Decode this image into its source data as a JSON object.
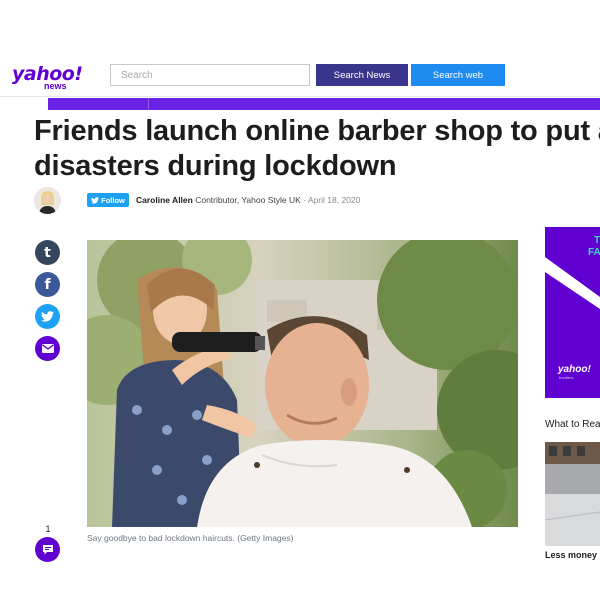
{
  "header": {
    "logo_main": "yahoo!",
    "logo_sub": "news",
    "search_placeholder": "Search",
    "search_news_label": "Search News",
    "search_web_label": "Search web"
  },
  "article": {
    "headline_line1": "Friends launch online barber shop to put an e",
    "headline_line2": "disasters during lockdown",
    "follow_label": "Follow",
    "author": "Caroline Allen",
    "role": "Contributor,",
    "outlet": "Yahoo Style UK",
    "separator": "·",
    "date": "April 18, 2020",
    "caption": "Say goodbye to bad lockdown haircuts. (Getty Images)"
  },
  "share": {
    "tumblr_glyph": "t",
    "facebook_glyph": "f",
    "comment_count": "1"
  },
  "rail": {
    "ad_text_line1": "T",
    "ad_text_line2": "FA",
    "ad_logo": "yahoo!",
    "ad_logo_sub": "frontiers",
    "what_to_read": "What to Rea",
    "story_title": "Less money b"
  },
  "icons": [
    "twitter-bird-icon",
    "mail-icon",
    "comment-icon",
    "tumblr-icon",
    "facebook-icon"
  ],
  "colors": {
    "brand_purple": "#6001d2",
    "search_news_bg": "#39358d",
    "search_web_bg": "#1d8bf1",
    "banner_purple": "#6b21e6",
    "follow_blue": "#1da1f2"
  }
}
